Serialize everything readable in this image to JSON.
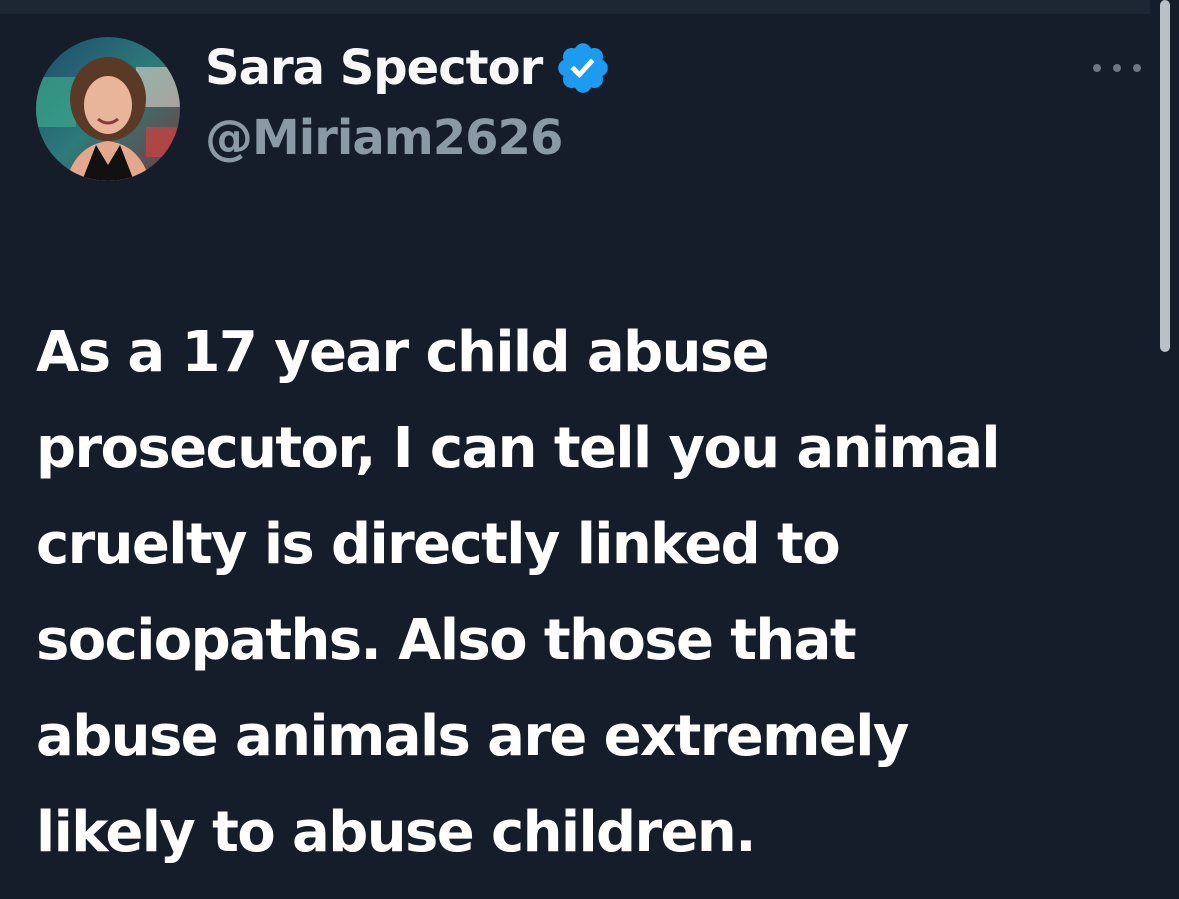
{
  "author": {
    "display_name": "Sara Spector",
    "handle": "@Miriam2626",
    "verified": true,
    "avatar_icon": "profile-photo"
  },
  "more_icon": "ellipsis-icon",
  "tweet": {
    "text": "As a 17 year child abuse\nprosecutor, I can tell you animal\ncruelty is directly linked to\nsociopaths. Also those that\nabuse animals are extremely\nlikely to abuse children."
  },
  "colors": {
    "background": "#151d2a",
    "text": "#ffffff",
    "secondary_text": "#8b98a5",
    "verified_badge": "#1d9bf0"
  }
}
